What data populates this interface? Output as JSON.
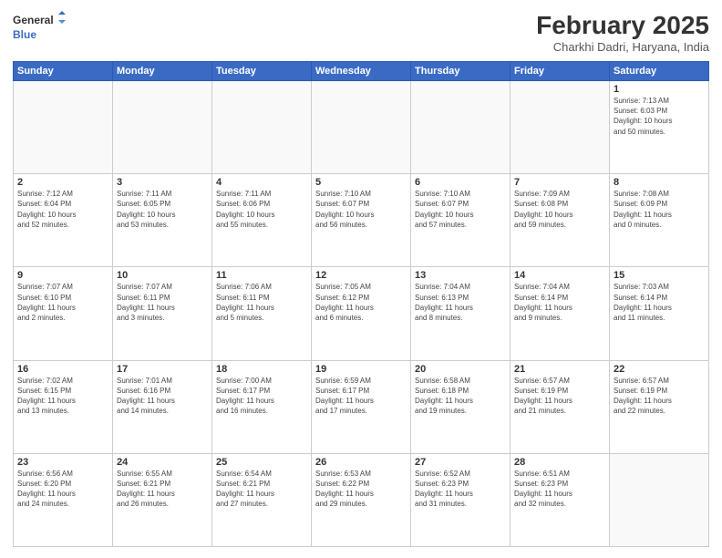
{
  "header": {
    "logo_line1": "General",
    "logo_line2": "Blue",
    "main_title": "February 2025",
    "subtitle": "Charkhi Dadri, Haryana, India"
  },
  "days_of_week": [
    "Sunday",
    "Monday",
    "Tuesday",
    "Wednesday",
    "Thursday",
    "Friday",
    "Saturday"
  ],
  "weeks": [
    [
      {
        "day": "",
        "info": ""
      },
      {
        "day": "",
        "info": ""
      },
      {
        "day": "",
        "info": ""
      },
      {
        "day": "",
        "info": ""
      },
      {
        "day": "",
        "info": ""
      },
      {
        "day": "",
        "info": ""
      },
      {
        "day": "1",
        "info": "Sunrise: 7:13 AM\nSunset: 6:03 PM\nDaylight: 10 hours\nand 50 minutes."
      }
    ],
    [
      {
        "day": "2",
        "info": "Sunrise: 7:12 AM\nSunset: 6:04 PM\nDaylight: 10 hours\nand 52 minutes."
      },
      {
        "day": "3",
        "info": "Sunrise: 7:11 AM\nSunset: 6:05 PM\nDaylight: 10 hours\nand 53 minutes."
      },
      {
        "day": "4",
        "info": "Sunrise: 7:11 AM\nSunset: 6:06 PM\nDaylight: 10 hours\nand 55 minutes."
      },
      {
        "day": "5",
        "info": "Sunrise: 7:10 AM\nSunset: 6:07 PM\nDaylight: 10 hours\nand 56 minutes."
      },
      {
        "day": "6",
        "info": "Sunrise: 7:10 AM\nSunset: 6:07 PM\nDaylight: 10 hours\nand 57 minutes."
      },
      {
        "day": "7",
        "info": "Sunrise: 7:09 AM\nSunset: 6:08 PM\nDaylight: 10 hours\nand 59 minutes."
      },
      {
        "day": "8",
        "info": "Sunrise: 7:08 AM\nSunset: 6:09 PM\nDaylight: 11 hours\nand 0 minutes."
      }
    ],
    [
      {
        "day": "9",
        "info": "Sunrise: 7:07 AM\nSunset: 6:10 PM\nDaylight: 11 hours\nand 2 minutes."
      },
      {
        "day": "10",
        "info": "Sunrise: 7:07 AM\nSunset: 6:11 PM\nDaylight: 11 hours\nand 3 minutes."
      },
      {
        "day": "11",
        "info": "Sunrise: 7:06 AM\nSunset: 6:11 PM\nDaylight: 11 hours\nand 5 minutes."
      },
      {
        "day": "12",
        "info": "Sunrise: 7:05 AM\nSunset: 6:12 PM\nDaylight: 11 hours\nand 6 minutes."
      },
      {
        "day": "13",
        "info": "Sunrise: 7:04 AM\nSunset: 6:13 PM\nDaylight: 11 hours\nand 8 minutes."
      },
      {
        "day": "14",
        "info": "Sunrise: 7:04 AM\nSunset: 6:14 PM\nDaylight: 11 hours\nand 9 minutes."
      },
      {
        "day": "15",
        "info": "Sunrise: 7:03 AM\nSunset: 6:14 PM\nDaylight: 11 hours\nand 11 minutes."
      }
    ],
    [
      {
        "day": "16",
        "info": "Sunrise: 7:02 AM\nSunset: 6:15 PM\nDaylight: 11 hours\nand 13 minutes."
      },
      {
        "day": "17",
        "info": "Sunrise: 7:01 AM\nSunset: 6:16 PM\nDaylight: 11 hours\nand 14 minutes."
      },
      {
        "day": "18",
        "info": "Sunrise: 7:00 AM\nSunset: 6:17 PM\nDaylight: 11 hours\nand 16 minutes."
      },
      {
        "day": "19",
        "info": "Sunrise: 6:59 AM\nSunset: 6:17 PM\nDaylight: 11 hours\nand 17 minutes."
      },
      {
        "day": "20",
        "info": "Sunrise: 6:58 AM\nSunset: 6:18 PM\nDaylight: 11 hours\nand 19 minutes."
      },
      {
        "day": "21",
        "info": "Sunrise: 6:57 AM\nSunset: 6:19 PM\nDaylight: 11 hours\nand 21 minutes."
      },
      {
        "day": "22",
        "info": "Sunrise: 6:57 AM\nSunset: 6:19 PM\nDaylight: 11 hours\nand 22 minutes."
      }
    ],
    [
      {
        "day": "23",
        "info": "Sunrise: 6:56 AM\nSunset: 6:20 PM\nDaylight: 11 hours\nand 24 minutes."
      },
      {
        "day": "24",
        "info": "Sunrise: 6:55 AM\nSunset: 6:21 PM\nDaylight: 11 hours\nand 26 minutes."
      },
      {
        "day": "25",
        "info": "Sunrise: 6:54 AM\nSunset: 6:21 PM\nDaylight: 11 hours\nand 27 minutes."
      },
      {
        "day": "26",
        "info": "Sunrise: 6:53 AM\nSunset: 6:22 PM\nDaylight: 11 hours\nand 29 minutes."
      },
      {
        "day": "27",
        "info": "Sunrise: 6:52 AM\nSunset: 6:23 PM\nDaylight: 11 hours\nand 31 minutes."
      },
      {
        "day": "28",
        "info": "Sunrise: 6:51 AM\nSunset: 6:23 PM\nDaylight: 11 hours\nand 32 minutes."
      },
      {
        "day": "",
        "info": ""
      }
    ]
  ]
}
